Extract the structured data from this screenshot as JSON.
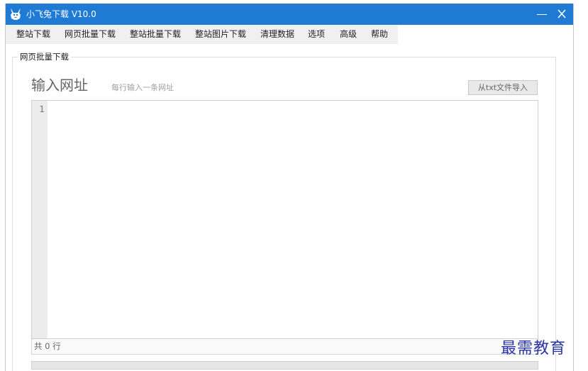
{
  "window": {
    "title": "小飞兔下载 V10.0",
    "close_glyph": "X",
    "colors": {
      "titlebar": "#1e7ad3",
      "menubar": "#f0f0f0"
    }
  },
  "menu": {
    "items": [
      "整站下载",
      "网页批量下载",
      "整站批量下载",
      "整站图片下载",
      "清理数据",
      "选项",
      "高级",
      "帮助"
    ]
  },
  "group": {
    "legend": "网页批量下载"
  },
  "urls_section": {
    "title": "输入网址",
    "hint": "每行输入一条网址",
    "import_button": "从txt文件导入"
  },
  "editor": {
    "line_numbers": [
      "1"
    ],
    "content": "",
    "line_count": "共 0 行"
  },
  "watermark": {
    "text": "最需教育",
    "color": "#2a35a8"
  },
  "icons": {
    "app": "rabbit-icon",
    "minimize": "minimize-icon",
    "close": "close-icon"
  }
}
